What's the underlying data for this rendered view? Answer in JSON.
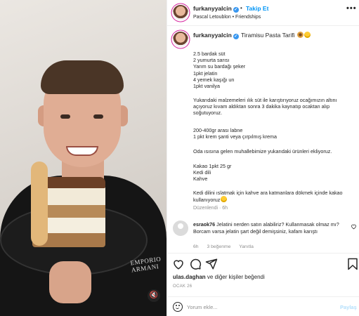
{
  "header": {
    "username": "furkanyyalcin",
    "follow_label": "Takip Et",
    "dot": "•",
    "audio": "Pascal Letoublon • Friendships",
    "more": "•••"
  },
  "caption": {
    "username": "furkanyyalcin",
    "title": "Tiramisu Pasta Tarifi",
    "ingredients": [
      "2.5 bardak süt",
      "2 yumurta sarısı",
      "Yarım su bardağı şeker",
      "1pkt jelatin",
      "4 yemek kaşığı un",
      "1pkt vanilya"
    ],
    "step1": "Yukarıdaki malzemeleri ılık süt ile karıştırıyoruz ocağımızın altını açıyoruz kıvam aldıktan sonra 3 dakika kaynatıp ocaktan alıp soğutuyoruz.",
    "cream": [
      "200-400gr arası labne",
      "1 pkt krem şanti veya çırpılmış krema"
    ],
    "step2": "Oda ısısına gelen muhallebimize yukarıdaki ürünleri ekliyoruz.",
    "layer": [
      "Kakao 1pkt 25 gr",
      "Kedi dili",
      "Kahve"
    ],
    "step3": "Kedi dilini ıslatmak için kahve ara katmanlara dökmek içinde kakao kullanıyoruz",
    "edited": "Düzenlendi · 6h"
  },
  "comment": {
    "username": "esraok76",
    "text": "Jelatini nerden satın alabiliriz? Kullanmasak olmaz mı? Borcam varsa jelatin şart değil demişsiniz, kafam karıştı",
    "time": "6h",
    "likes": "3 beğenme",
    "reply": "Yanıtla"
  },
  "likes": {
    "user": "ulas.daghan",
    "rest": "ve diğer kişiler beğendi"
  },
  "date": "OCAK 26",
  "comment_box": {
    "placeholder": "Yorum ekle...",
    "post_label": "Paylaş"
  },
  "media": {
    "brand_text": "EMPORIO ARMANI"
  },
  "colors": {
    "accent": "#0095f6",
    "verified": "#3897f0",
    "muted": "#8e8e8e"
  }
}
